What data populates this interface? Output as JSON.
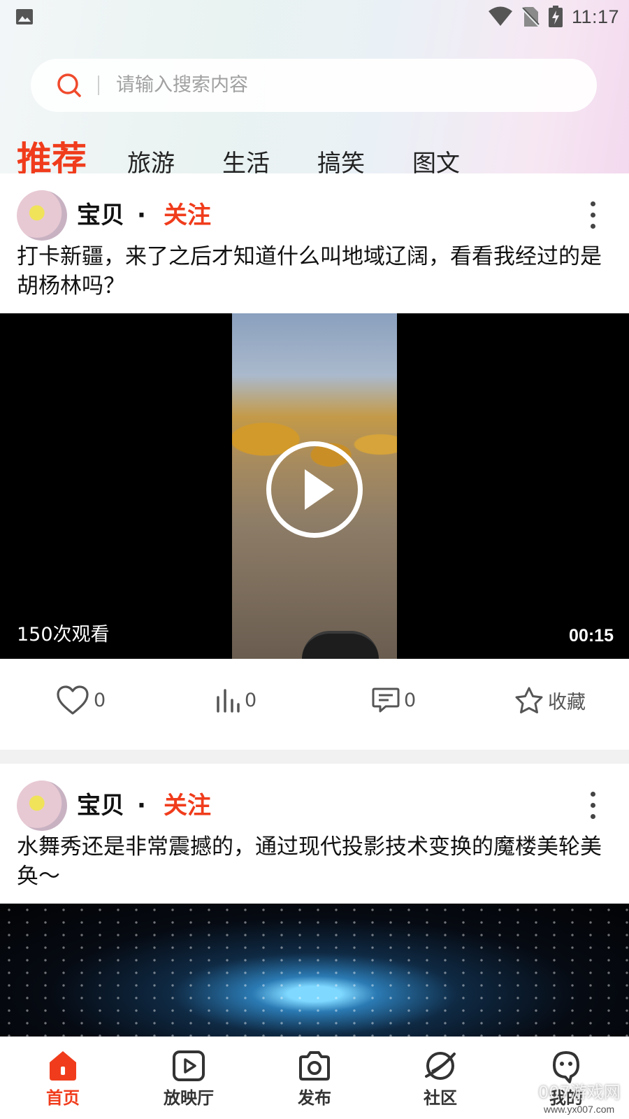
{
  "status_bar": {
    "time": "11:17"
  },
  "search": {
    "placeholder": "请输入搜索内容"
  },
  "tabs": [
    {
      "label": "推荐",
      "active": true
    },
    {
      "label": "旅游"
    },
    {
      "label": "生活"
    },
    {
      "label": "搞笑"
    },
    {
      "label": "图文"
    }
  ],
  "posts": [
    {
      "author": "宝贝",
      "separator": "·",
      "follow_label": "关注",
      "title": "打卡新疆，来了之后才知道什么叫地域辽阔，看看我经过的是胡杨林吗？",
      "video": {
        "views": "150次观看",
        "duration": "00:15"
      },
      "actions": {
        "likes": "0",
        "stats": "0",
        "comments": "0",
        "collect_label": "收藏"
      }
    },
    {
      "author": "宝贝",
      "separator": "·",
      "follow_label": "关注",
      "title": "水舞秀还是非常震撼的，通过现代投影技术变换的魔楼美轮美奂～"
    }
  ],
  "bottom_nav": [
    {
      "label": "首页",
      "icon": "home-icon",
      "active": true
    },
    {
      "label": "放映厅",
      "icon": "play-square-icon"
    },
    {
      "label": "发布",
      "icon": "camera-icon"
    },
    {
      "label": "社区",
      "icon": "planet-icon"
    },
    {
      "label": "我的",
      "icon": "ghost-mascot-icon"
    }
  ],
  "watermark": {
    "text": "007游戏网",
    "sub": "www.yx007.com"
  },
  "colors": {
    "accent": "#f03c1c"
  }
}
